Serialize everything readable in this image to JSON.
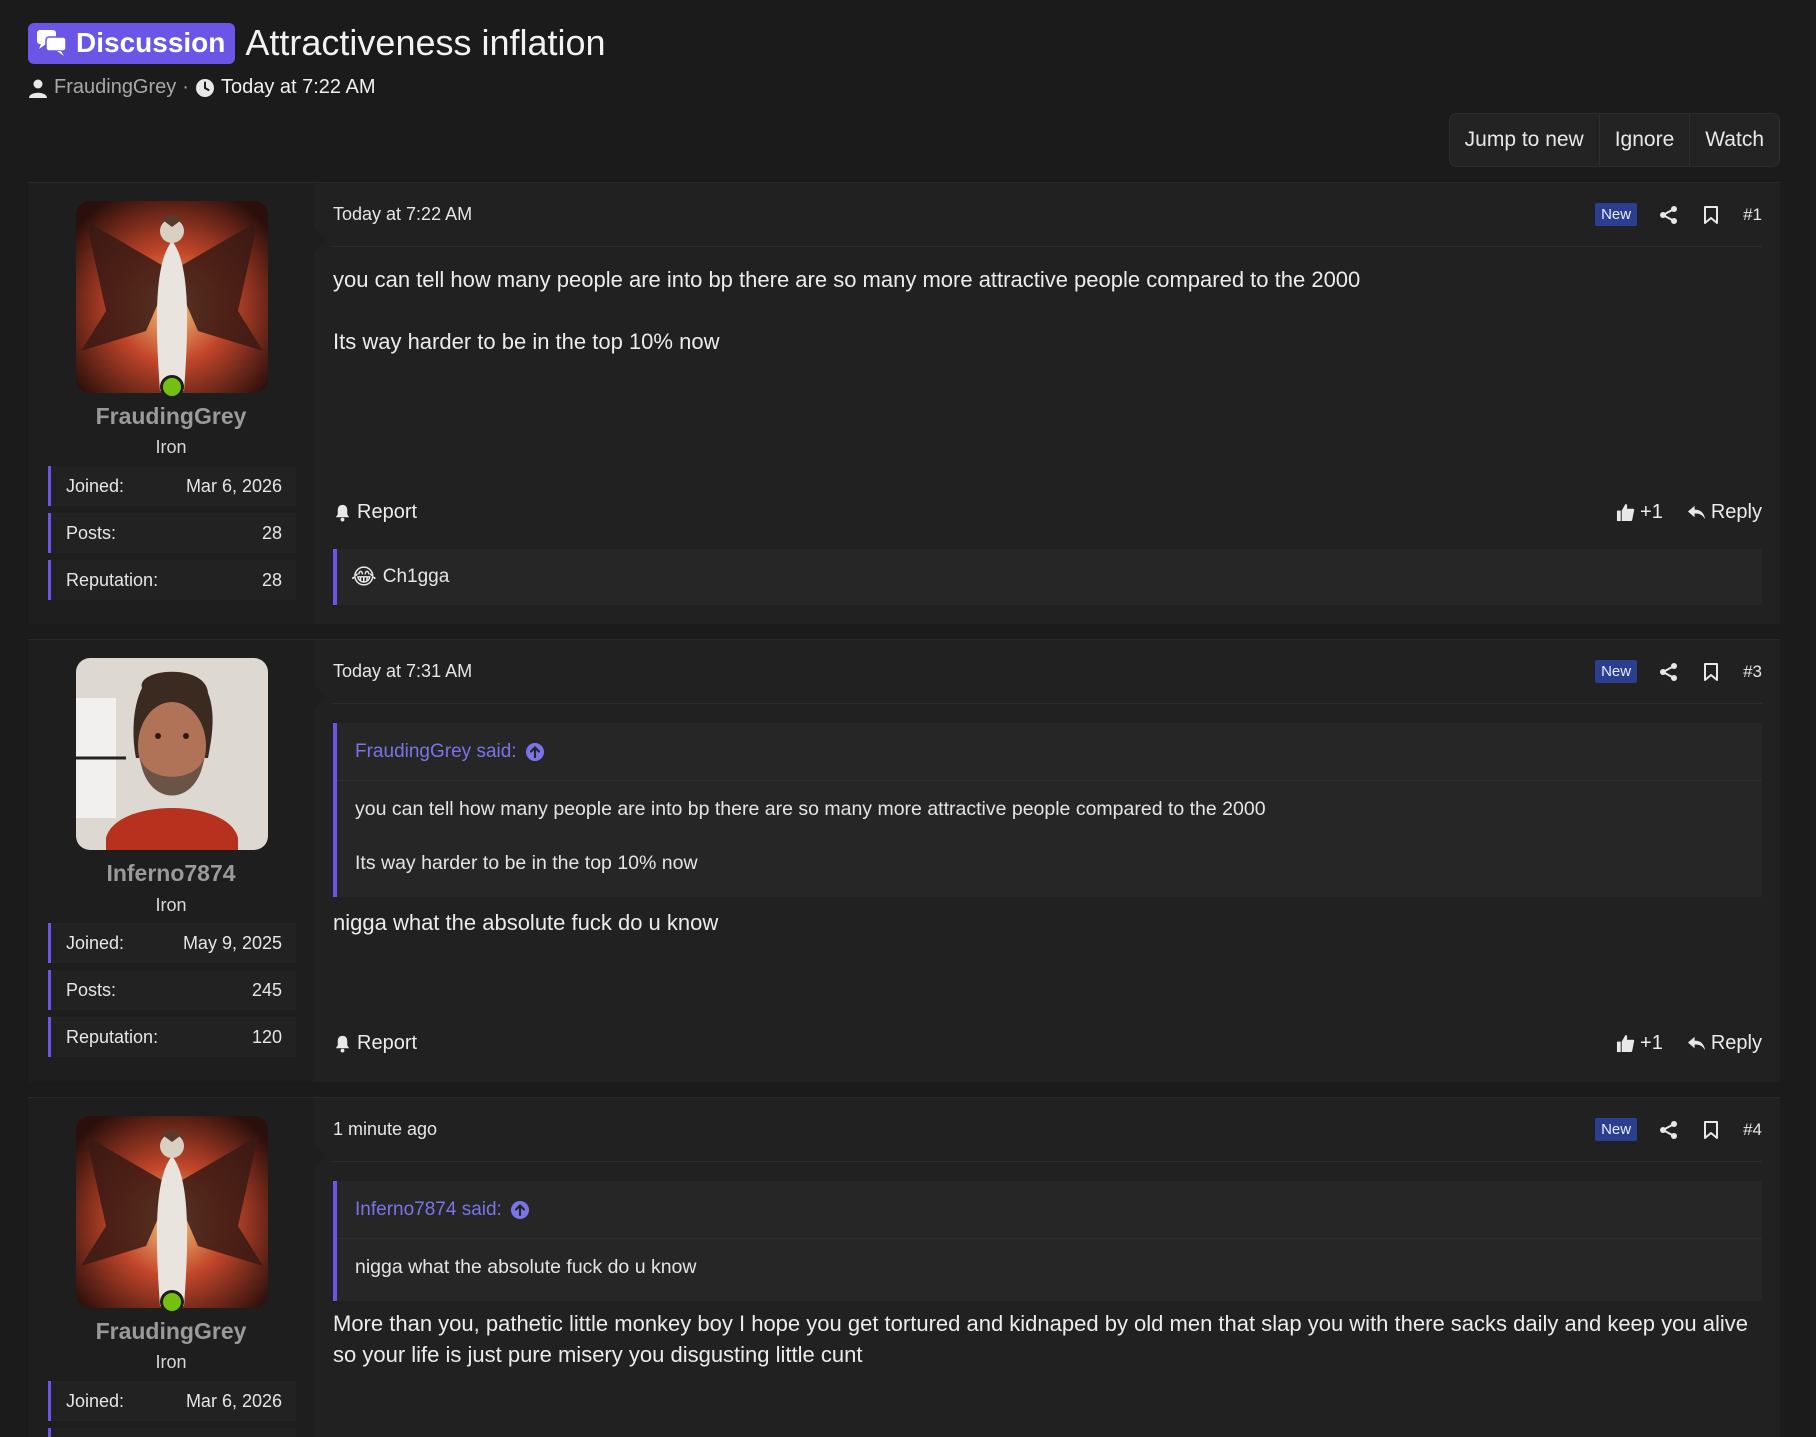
{
  "thread": {
    "prefix": "Discussion",
    "title": "Attractiveness inflation",
    "author": "FraudingGrey",
    "separator": "·",
    "started": "Today at 7:22 AM"
  },
  "thread_buttons": {
    "jump": "Jump to new",
    "ignore": "Ignore",
    "watch": "Watch"
  },
  "stat_labels": {
    "joined": "Joined:",
    "posts": "Posts:",
    "reputation": "Reputation:"
  },
  "actions": {
    "report": "Report",
    "like_count": "+1",
    "reply": "Reply"
  },
  "posts": [
    {
      "user": {
        "name": "FraudingGrey",
        "title": "Iron",
        "joined": "Mar 6, 2026",
        "posts": "28",
        "reputation": "28"
      },
      "time": "Today at 7:22 AM",
      "badge": "New",
      "number": "#1",
      "body": [
        "you can tell how many people are into bp there are so many more attractive people compared to the 2000",
        "Its way harder to be in the top 10% now"
      ],
      "reaction": {
        "emoji": "😂",
        "user": "Ch1gga"
      }
    },
    {
      "user": {
        "name": "Inferno7874",
        "title": "Iron",
        "joined": "May 9, 2025",
        "posts": "245",
        "reputation": "120"
      },
      "time": "Today at 7:31 AM",
      "badge": "New",
      "number": "#3",
      "quote": {
        "author": "FraudingGrey said:",
        "lines": [
          "you can tell how many people are into bp there are so many more attractive people compared to the 2000",
          "Its way harder to be in the top 10% now"
        ]
      },
      "body": [
        "nigga what the absolute fuck do u know"
      ]
    },
    {
      "user": {
        "name": "FraudingGrey",
        "title": "Iron",
        "joined": "Mar 6, 2026"
      },
      "time": "1 minute ago",
      "badge": "New",
      "number": "#4",
      "quote": {
        "author": "Inferno7874 said:",
        "lines": [
          "nigga what the absolute fuck do u know"
        ]
      },
      "body": [
        "More than you, pathetic little monkey boy I hope you get tortured and kidnaped by old men that slap you with there sacks daily and keep you alive so your life is just pure misery you disgusting little cunt"
      ]
    }
  ],
  "colors": {
    "accent": "#6a55e6",
    "badge": "#2b3e8f",
    "online": "#74c010",
    "quote_author": "#7b74e8"
  },
  "icons": [
    "discussion-icon",
    "user-icon",
    "clock-icon",
    "share-icon",
    "bookmark-icon",
    "bell-icon",
    "thumbs-up-icon",
    "reply-icon",
    "arrow-up-circle-icon",
    "online-indicator"
  ]
}
